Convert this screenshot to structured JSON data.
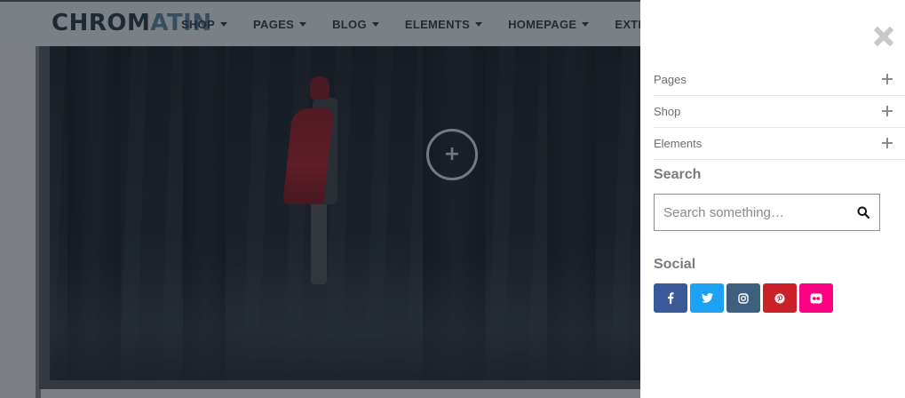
{
  "header": {
    "logo_part1": "CHROM",
    "logo_part2": "ATIN",
    "nav": [
      "SHOP",
      "PAGES",
      "BLOG",
      "ELEMENTS",
      "HOMEPAGE",
      "EXTRAS"
    ]
  },
  "panel": {
    "menu_items": [
      "Pages",
      "Shop",
      "Elements"
    ],
    "search_title": "Search",
    "search_placeholder": "Search something…",
    "social_title": "Social",
    "social": [
      {
        "name": "facebook",
        "color": "#3b5998"
      },
      {
        "name": "twitter",
        "color": "#1da1f2"
      },
      {
        "name": "instagram",
        "color": "#3f5f7f"
      },
      {
        "name": "pinterest",
        "color": "#cb2027"
      },
      {
        "name": "flickr",
        "color": "#ff0084"
      }
    ]
  },
  "colors": {
    "accent_dark": "#1a2733",
    "accent_logo": "#3f5f79"
  }
}
